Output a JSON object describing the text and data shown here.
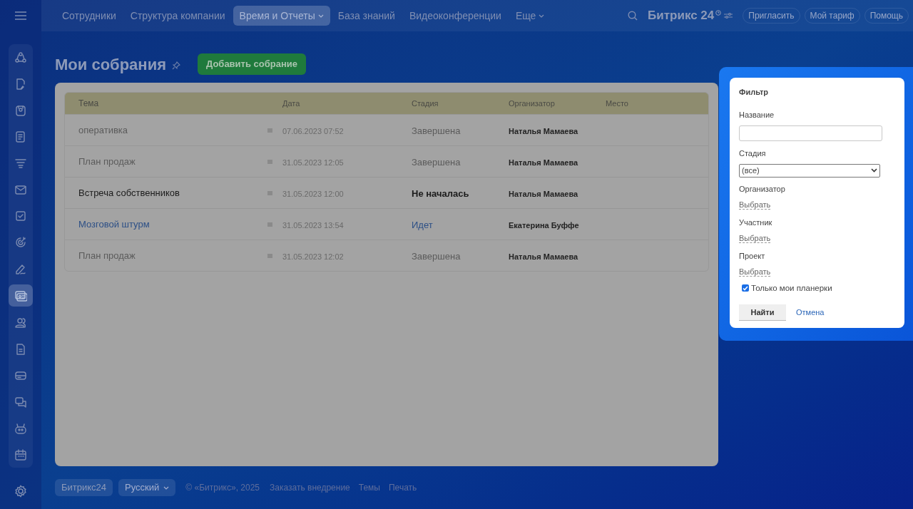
{
  "top_nav": {
    "items": [
      {
        "label": "Сотрудники",
        "selected": false,
        "dropdown": false
      },
      {
        "label": "Структура компании",
        "selected": false,
        "dropdown": false
      },
      {
        "label": "Время и Отчеты",
        "selected": true,
        "dropdown": true
      },
      {
        "label": "База знаний",
        "selected": false,
        "dropdown": false
      },
      {
        "label": "Видеоконференции",
        "selected": false,
        "dropdown": false
      },
      {
        "label": "Еще",
        "selected": false,
        "dropdown": true
      }
    ],
    "logo": "Битрикс 24",
    "buttons": [
      "Пригласить",
      "Мой тариф",
      "Помощь"
    ]
  },
  "sidebar": {
    "items": [
      {
        "kind": "flow",
        "selected": false
      },
      {
        "kind": "note",
        "selected": false
      },
      {
        "kind": "box",
        "selected": false
      },
      {
        "kind": "doc",
        "selected": false
      },
      {
        "kind": "funnel",
        "selected": false
      },
      {
        "kind": "mail",
        "selected": false
      },
      {
        "kind": "task",
        "selected": false
      },
      {
        "kind": "target",
        "selected": false
      },
      {
        "kind": "pen",
        "selected": false
      },
      {
        "kind": "card",
        "selected": true
      },
      {
        "kind": "people",
        "selected": false
      },
      {
        "kind": "file",
        "selected": false
      },
      {
        "kind": "drive",
        "selected": false
      },
      {
        "kind": "chat",
        "selected": false
      },
      {
        "kind": "robot",
        "selected": false
      },
      {
        "kind": "calendar",
        "selected": false
      }
    ]
  },
  "page": {
    "title": "Мои собрания",
    "add_button": "Добавить собрание"
  },
  "table": {
    "columns": [
      "Тема",
      "Дата",
      "Стадия",
      "Организатор",
      "Место"
    ],
    "rows": [
      {
        "topic": "оперативка",
        "date": "07.06.2023 07:52",
        "stage": "Завершена",
        "kind": "done",
        "organizer": "Наталья Мамаева"
      },
      {
        "topic": "План продаж",
        "date": "31.05.2023 12:05",
        "stage": "Завершена",
        "kind": "done",
        "organizer": "Наталья Мамаева"
      },
      {
        "topic": "Встреча собственников",
        "date": "31.05.2023 12:00",
        "stage": "Не началась",
        "kind": "pending",
        "organizer": "Наталья Мамаева"
      },
      {
        "topic": "Мозговой штурм",
        "date": "31.05.2023 13:54",
        "stage": "Идет",
        "kind": "active",
        "organizer": "Екатерина Буффе"
      },
      {
        "topic": "План продаж",
        "date": "31.05.2023 12:02",
        "stage": "Завершена",
        "kind": "done",
        "organizer": "Наталья Мамаева"
      }
    ]
  },
  "filter": {
    "title": "Фильтр",
    "name_label": "Название",
    "stage_label": "Стадия",
    "stage_value": "(все)",
    "pickers": [
      {
        "label": "Организатор",
        "link": "Выбрать"
      },
      {
        "label": "Участник",
        "link": "Выбрать"
      },
      {
        "label": "Проект",
        "link": "Выбрать"
      }
    ],
    "only_mine": {
      "label": "Только мои планерки",
      "checked": true
    },
    "find_button": "Найти",
    "cancel_link": "Отмена"
  },
  "footer": {
    "brand": "Битрикс24",
    "language": "Русский",
    "copyright": "© «Битрикс», 2025",
    "links": [
      "Заказать внедрение",
      "Темы",
      "Печать"
    ]
  }
}
